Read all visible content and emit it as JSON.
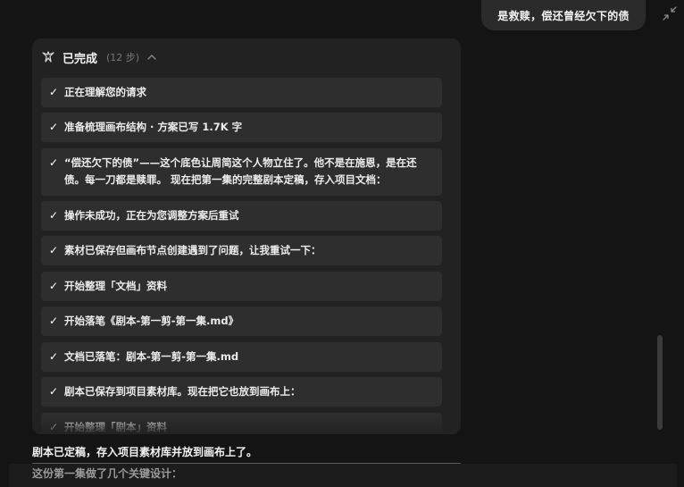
{
  "user_message": "是救赎，偿还曾经欠下的债",
  "card": {
    "title": "已完成",
    "steps_count": "(12 步)",
    "steps": [
      "正在理解您的请求",
      "准备梳理画布结构 · 方案已写 1.7K 字",
      "“偿还欠下的债”——这个底色让周简这个人物立住了。他不是在施恩，是在还债。每一刀都是赎罪。 现在把第一集的完整剧本定稿，存入项目文档：",
      "操作未成功，正在为您调整方案后重试",
      "素材已保存但画布节点创建遇到了问题，让我重试一下：",
      "开始整理「文档」资料",
      "开始落笔《剧本-第一剪-第一集.md》",
      "文档已落笔：剧本-第一剪-第一集.md",
      "剧本已保存到项目素材库。现在把它也放到画布上：",
      "开始整理「剧本」资料"
    ]
  },
  "result_text": "剧本已定稿，存入项目素材库并放到画布上了。",
  "design_text": "这份第一集做了几个关键设计：",
  "icons": {
    "collapse": "collapse-arrows-icon",
    "header": "sparkle-agent-icon",
    "chevron": "chevron-up-icon",
    "check": "checkmark-icon"
  }
}
